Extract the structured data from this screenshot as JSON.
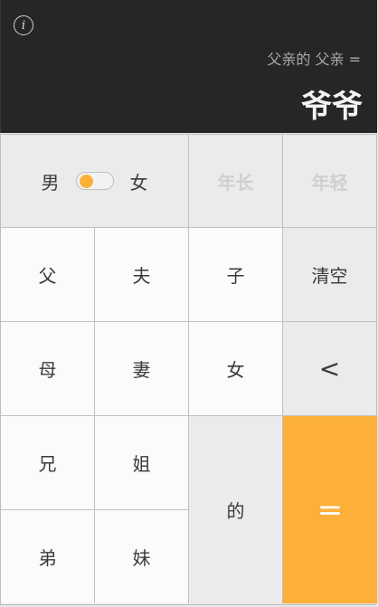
{
  "display": {
    "expression": "父亲的 父亲 =",
    "result": "爷爷"
  },
  "keys": {
    "male": "男",
    "female_toggle": "女",
    "older": "年长",
    "younger": "年轻",
    "father": "父",
    "husband": "夫",
    "son": "子",
    "clear": "清空",
    "mother": "母",
    "wife": "妻",
    "daughter": "女",
    "backspace": "<",
    "elder_brother": "兄",
    "elder_sister": "姐",
    "of": "的",
    "equals": "=",
    "younger_brother": "弟",
    "younger_sister": "妹"
  },
  "gender_toggle": {
    "selected": "male"
  },
  "colors": {
    "accent": "#fcb03a",
    "display_bg": "#262626"
  }
}
